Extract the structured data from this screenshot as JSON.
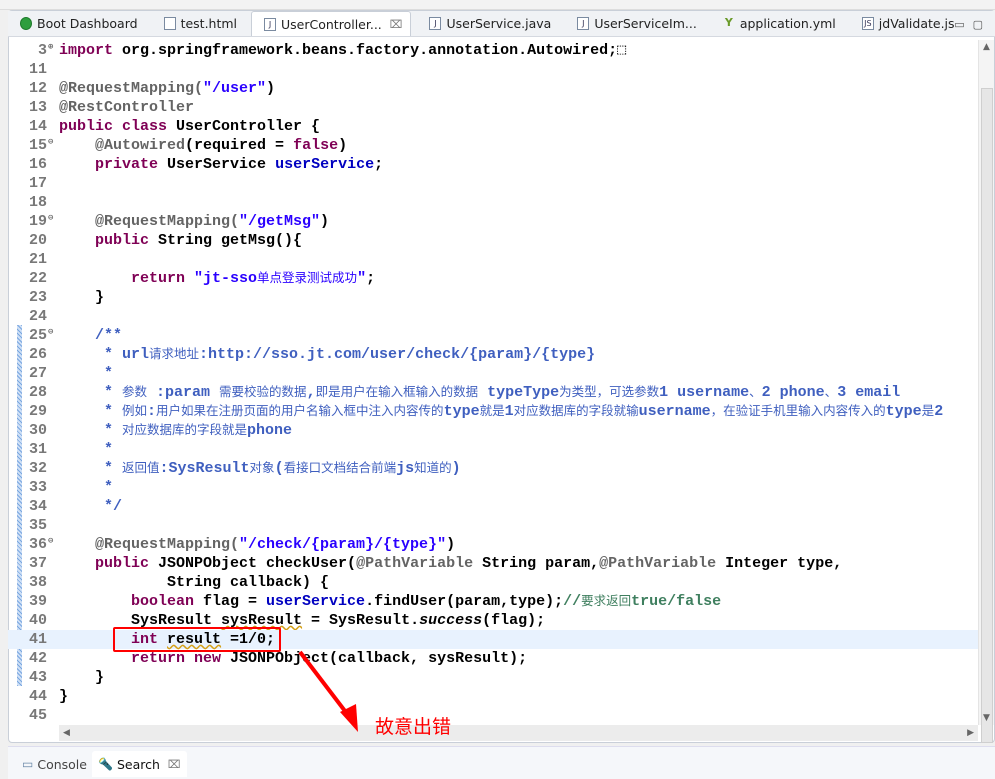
{
  "tabs": [
    {
      "label": "Boot Dashboard",
      "icon": "spring-boot-icon"
    },
    {
      "label": "test.html",
      "icon": "html-file-icon"
    },
    {
      "label": "UserController...",
      "icon": "java-file-icon",
      "active": true,
      "close": "⌧"
    },
    {
      "label": "UserService.java",
      "icon": "java-file-icon"
    },
    {
      "label": "UserServiceIm...",
      "icon": "java-file-icon"
    },
    {
      "label": "application.yml",
      "icon": "yaml-file-icon"
    },
    {
      "label": "jdValidate.js",
      "icon": "js-file-icon"
    }
  ],
  "code": [
    {
      "n": "3",
      "fold": "⊕",
      "s": [
        [
          "import ",
          "kw"
        ],
        [
          "org.springframework.beans.factory.annotation.Autowired;",
          "pl"
        ],
        [
          "⬚",
          "pl"
        ]
      ]
    },
    {
      "n": "11",
      "s": []
    },
    {
      "n": "12",
      "s": [
        [
          "@RequestMapping(",
          "ann"
        ],
        [
          "\"/user\"",
          "str"
        ],
        [
          ")",
          "pl"
        ]
      ]
    },
    {
      "n": "13",
      "s": [
        [
          "@RestController",
          "ann"
        ]
      ]
    },
    {
      "n": "14",
      "s": [
        [
          "public class ",
          "kw"
        ],
        [
          "UserController {",
          "pl"
        ]
      ]
    },
    {
      "n": "15",
      "fold": "⊖",
      "s": [
        [
          "    @Autowired",
          "ann"
        ],
        [
          "(required = ",
          "pl"
        ],
        [
          "false",
          "kw"
        ],
        [
          ")",
          "pl"
        ]
      ]
    },
    {
      "n": "16",
      "s": [
        [
          "    private ",
          "kw"
        ],
        [
          "UserService ",
          "pl"
        ],
        [
          "userService",
          "fld"
        ],
        [
          ";",
          "pl"
        ]
      ]
    },
    {
      "n": "17",
      "s": []
    },
    {
      "n": "18",
      "s": []
    },
    {
      "n": "19",
      "fold": "⊖",
      "s": [
        [
          "    @RequestMapping(",
          "ann"
        ],
        [
          "\"/getMsg\"",
          "str"
        ],
        [
          ")",
          "pl"
        ]
      ]
    },
    {
      "n": "20",
      "s": [
        [
          "    public ",
          "kw"
        ],
        [
          "String getMsg(){",
          "pl"
        ]
      ]
    },
    {
      "n": "21",
      "s": []
    },
    {
      "n": "22",
      "s": [
        [
          "        return ",
          "kw"
        ],
        [
          "\"jt-sso单点登录测试成功\"",
          "str"
        ],
        [
          ";",
          "pl"
        ]
      ]
    },
    {
      "n": "23",
      "s": [
        [
          "    }",
          "pl"
        ]
      ]
    },
    {
      "n": "24",
      "s": []
    },
    {
      "n": "25",
      "fold": "⊖",
      "s": [
        [
          "    /**",
          "doc"
        ]
      ]
    },
    {
      "n": "26",
      "s": [
        [
          "     * url请求地址:http://sso.jt.com/user/check/{param}/{type}",
          "doc"
        ]
      ]
    },
    {
      "n": "27",
      "s": [
        [
          "     *",
          "doc"
        ]
      ]
    },
    {
      "n": "28",
      "s": [
        [
          "     * 参数 :param 需要校验的数据,即是用户在输入框输入的数据 typeType为类型，可选参数1 username、2 phone、3 email",
          "doc"
        ]
      ]
    },
    {
      "n": "29",
      "s": [
        [
          "     * 例如:用户如果在注册页面的用户名输入框中注入内容传的type就是1对应数据库的字段就输username，在验证手机里输入内容传入的type是2",
          "doc"
        ]
      ]
    },
    {
      "n": "30",
      "s": [
        [
          "     * 对应数据库的字段就是phone",
          "doc"
        ]
      ]
    },
    {
      "n": "31",
      "s": [
        [
          "     *",
          "doc"
        ]
      ]
    },
    {
      "n": "32",
      "s": [
        [
          "     * 返回值:SysResult对象(看接口文档结合前端js知道的)",
          "doc"
        ]
      ]
    },
    {
      "n": "33",
      "s": [
        [
          "     *",
          "doc"
        ]
      ]
    },
    {
      "n": "34",
      "s": [
        [
          "     */",
          "doc"
        ]
      ]
    },
    {
      "n": "35",
      "s": []
    },
    {
      "n": "36",
      "fold": "⊖",
      "s": [
        [
          "    @RequestMapping(",
          "ann"
        ],
        [
          "\"/check/{param}/{type}\"",
          "str"
        ],
        [
          ")",
          "pl"
        ]
      ]
    },
    {
      "n": "37",
      "s": [
        [
          "    public ",
          "kw"
        ],
        [
          "JSONPObject checkUser(",
          "pl"
        ],
        [
          "@PathVariable",
          "ann"
        ],
        [
          " String param,",
          "pl"
        ],
        [
          "@PathVariable",
          "ann"
        ],
        [
          " Integer type,",
          "pl"
        ]
      ]
    },
    {
      "n": "38",
      "s": [
        [
          "            String callback) {",
          "pl"
        ]
      ]
    },
    {
      "n": "39",
      "s": [
        [
          "        boolean ",
          "kw"
        ],
        [
          "flag = ",
          "pl"
        ],
        [
          "userService",
          "fld"
        ],
        [
          ".findUser(param,type);",
          "pl"
        ],
        [
          "//要求返回true/false",
          "cmt"
        ]
      ]
    },
    {
      "n": "40",
      "s": [
        [
          "        SysResult ",
          "pl"
        ],
        [
          "sysResult",
          "err"
        ],
        [
          " = SysResult.",
          "pl"
        ],
        [
          "success",
          "it"
        ],
        [
          "(flag);",
          "pl"
        ]
      ]
    },
    {
      "n": "41",
      "cur": true,
      "s": [
        [
          "        int ",
          "kw"
        ],
        [
          "result",
          "err"
        ],
        [
          " =1/0;",
          "pl"
        ]
      ]
    },
    {
      "n": "42",
      "s": [
        [
          "        return new ",
          "kw"
        ],
        [
          "JSONPObject(callback, sysResult);",
          "pl"
        ]
      ]
    },
    {
      "n": "43",
      "s": [
        [
          "    }",
          "pl"
        ]
      ]
    },
    {
      "n": "44",
      "s": [
        [
          "}",
          "pl"
        ]
      ]
    },
    {
      "n": "45",
      "s": []
    }
  ],
  "annotation": "故意出错",
  "bottom_tabs": [
    {
      "label": "Console",
      "icon": "console-icon"
    },
    {
      "label": "Search",
      "icon": "search-icon",
      "active": true,
      "close": "⌧"
    }
  ],
  "colors": {
    "keyword": "#7f0055",
    "string": "#2a00ff",
    "annotation": "#646464",
    "field": "#0000c0",
    "javadoc": "#3f5fbf",
    "comment": "#3f7f5f",
    "highlight": "#ff0000"
  }
}
